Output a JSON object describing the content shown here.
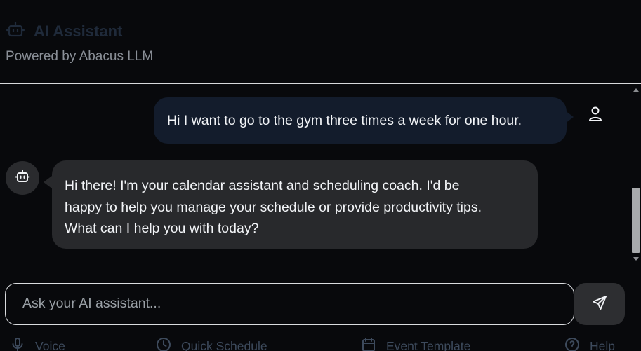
{
  "header": {
    "title": "AI Assistant",
    "subtitle": "Powered by Abacus LLM",
    "icon": "robot-icon"
  },
  "messages": [
    {
      "role": "user",
      "text": "Hi I want to go to the gym three times a week for one hour.",
      "icon": "user-icon"
    },
    {
      "role": "assistant",
      "lines": [
        "Hi there! I'm your calendar assistant and scheduling coach. I'd be",
        "happy to help you manage your schedule or provide productivity tips.",
        "What can I help you with today?"
      ],
      "icon": "robot-icon"
    }
  ],
  "composer": {
    "placeholder": "Ask your AI assistant...",
    "value": "",
    "send_icon": "send-icon"
  },
  "footer": {
    "voice": "Voice",
    "quick_schedule": "Quick Schedule",
    "event_template": "Event Template",
    "help": "Help"
  },
  "colors": {
    "background": "#08090c",
    "user_bubble": "#131c2c",
    "assistant_bubble": "#28292c",
    "muted_footer": "#3d4a5c"
  }
}
